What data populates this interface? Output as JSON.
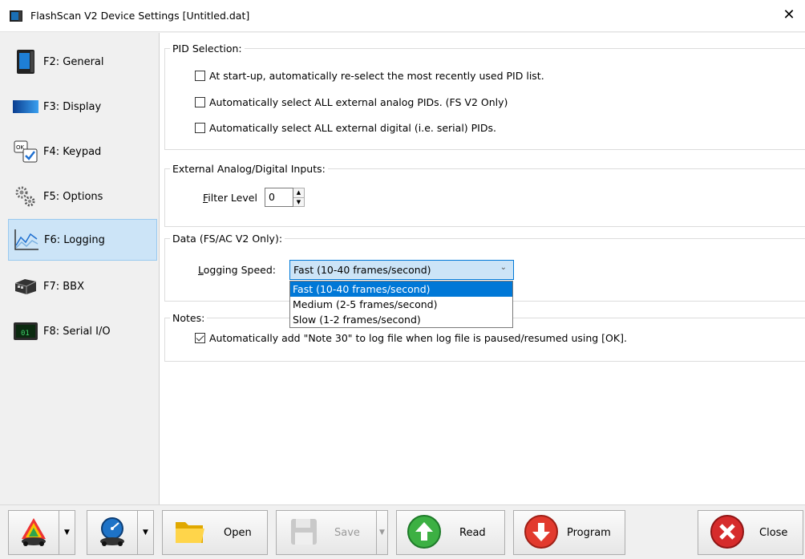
{
  "window": {
    "title": "FlashScan V2 Device Settings [Untitled.dat]",
    "close_glyph": "✕"
  },
  "sidebar": {
    "items": [
      {
        "label": "F2: General",
        "icon": "device-icon"
      },
      {
        "label": "F3: Display",
        "icon": "display-icon"
      },
      {
        "label": "F4: Keypad",
        "icon": "keypad-icon"
      },
      {
        "label": "F5: Options",
        "icon": "gears-icon"
      },
      {
        "label": "F6: Logging",
        "icon": "chart-icon",
        "selected": true
      },
      {
        "label": "F7: BBX",
        "icon": "bbx-icon"
      },
      {
        "label": "F8: Serial I/O",
        "icon": "serial-icon"
      }
    ]
  },
  "pid_selection": {
    "legend": "PID Selection:",
    "options": [
      {
        "label": "At start-up, automatically re-select the most recently used PID list.",
        "checked": false
      },
      {
        "label": "Automatically select ALL external analog PIDs. (FS V2 Only)",
        "checked": false
      },
      {
        "label": "Automatically select ALL external digital (i.e. serial) PIDs.",
        "checked": false
      }
    ]
  },
  "external_inputs": {
    "legend": "External Analog/Digital Inputs:",
    "filter_label_underlined": "F",
    "filter_label_rest": "ilter Level",
    "filter_value": "0"
  },
  "data_group": {
    "legend": "Data  (FS/AC V2 Only):",
    "speed_label_underlined": "L",
    "speed_label_rest": "ogging Speed:",
    "selected": "Fast (10-40 frames/second)",
    "options": [
      "Fast (10-40 frames/second)",
      "Medium (2-5 frames/second)",
      "Slow (1-2 frames/second)"
    ]
  },
  "notes": {
    "legend": "Notes:",
    "option": {
      "label": "Automatically add \"Note 30\" to log file when log file is paused/resumed using [OK].",
      "checked": true
    }
  },
  "toolbar": {
    "open_label": "Open",
    "save_label": "Save",
    "read_label": "Read",
    "program_label": "Program",
    "close_label": "Close"
  }
}
